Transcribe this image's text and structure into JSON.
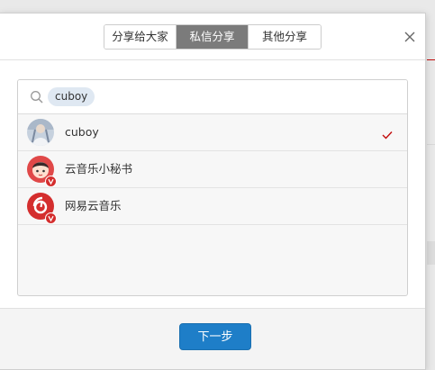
{
  "tabs": [
    {
      "label": "分享给大家",
      "active": false
    },
    {
      "label": "私信分享",
      "active": true
    },
    {
      "label": "其他分享",
      "active": false
    }
  ],
  "search": {
    "chip_text": "cuboy"
  },
  "recipients": [
    {
      "name": "cuboy",
      "selected": true,
      "avatar": "user-photo-avatar"
    },
    {
      "name": "云音乐小秘书",
      "selected": false,
      "avatar": "cartoon-girl-avatar"
    },
    {
      "name": "网易云音乐",
      "selected": false,
      "avatar": "netease-music-logo-avatar"
    }
  ],
  "footer": {
    "next_label": "下一步"
  },
  "colors": {
    "accent_button": "#1e7ec8",
    "active_tab": "#7b7b7b",
    "check": "#c20c0c",
    "brand_red": "#d42e2e"
  }
}
